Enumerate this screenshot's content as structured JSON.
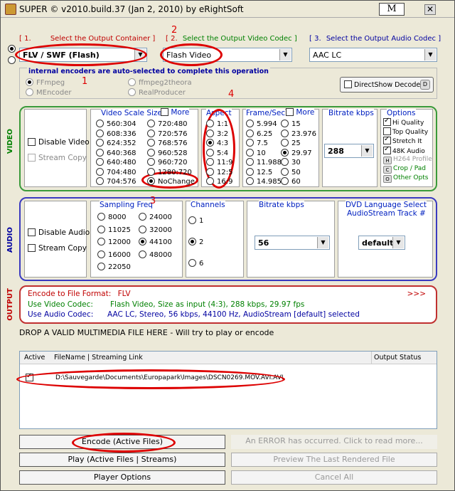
{
  "title": "SUPER © v2010.build.37 (Jan 2, 2010) by eRightSoft",
  "title_button": "M",
  "close_glyph": "✕",
  "step1": {
    "num": "[ 1.",
    "label": "Select the Output Container ]"
  },
  "step2": {
    "num": "[ 2.",
    "label": "Select the Output Video Codec ]"
  },
  "step3": {
    "num": "[ 3.",
    "label": "Select the Output Audio Codec ]"
  },
  "container_value": "FLV / SWF (Flash)",
  "video_codec_value": "Flash Video",
  "audio_codec_value": "AAC LC",
  "encoders": {
    "caption": "internal encoders are auto-selected to complete this operation",
    "items": [
      "FFmpeg",
      "ffmpeg2theora",
      "MEncoder",
      "RealProducer"
    ],
    "directshow": "DirectShow Decode",
    "directshow_badge": "D"
  },
  "video": {
    "section_label": "VIDEO",
    "disable": "Disable Video",
    "stream_copy": "Stream Copy",
    "scale_title": "Video Scale Size",
    "scale_more": "More",
    "scale_col1": [
      "560:304",
      "608:336",
      "624:352",
      "640:368",
      "640:480",
      "704:480",
      "704:576"
    ],
    "scale_col2": [
      "720:480",
      "720:576",
      "768:576",
      "960:528",
      "960:720",
      "1280:720",
      "NoChange"
    ],
    "aspect_title": "Aspect",
    "aspect": [
      "1:1",
      "3:2",
      "4:3",
      "5:4",
      "11:9",
      "12:5",
      "16:9"
    ],
    "fps_title": "Frame/Sec",
    "fps_more": "More",
    "fps_col1": [
      "5.994",
      "6.25",
      "7.5",
      "10",
      "11.988",
      "12.5",
      "14.985"
    ],
    "fps_col2": [
      "15",
      "23.976",
      "25",
      "29.97",
      "30",
      "50",
      "60"
    ],
    "bitrate_title": "Bitrate  kbps",
    "bitrate_value": "288",
    "options_title": "Options",
    "options": [
      "Hi Quality",
      "Top Quality",
      "Stretch It",
      "48K Audio",
      "H264 Profile",
      "Crop / Pad",
      "Other Opts"
    ],
    "options_badges": [
      "",
      "",
      "",
      "",
      "H",
      "C",
      "O"
    ]
  },
  "audio": {
    "section_label": "AUDIO",
    "disable": "Disable Audio",
    "stream_copy": "Stream Copy",
    "freq_title": "Sampling Freq",
    "freq_col1": [
      "8000",
      "11025",
      "12000",
      "16000",
      "22050"
    ],
    "freq_col2": [
      "24000",
      "32000",
      "44100",
      "48000"
    ],
    "channels_title": "Channels",
    "channels": [
      "1",
      "2",
      "6"
    ],
    "bitrate_title": "Bitrate  kbps",
    "bitrate_value": "56",
    "dvd_title": "DVD Language Select",
    "dvd_sub": "AudioStream  Track #",
    "dvd_value": "default"
  },
  "output": {
    "section_label": "OUTPUT",
    "format_label": "Encode to File Format:",
    "format_value": "FLV",
    "more": ">>>",
    "video_label": "Use Video Codec:",
    "video_value": "Flash Video,   Size as input (4:3),   288 kbps,   29.97 fps",
    "audio_label": "Use Audio Codec:",
    "audio_value": "AAC LC,   Stereo,   56 kbps,   44100 Hz,   AudioStream [default] selected"
  },
  "drop_text": "DROP A VALID MULTIMEDIA FILE HERE - Will try to play or encode",
  "filelist": {
    "columns": [
      "Active",
      "FileName  |  Streaming Link",
      "Output Status"
    ],
    "rows": [
      {
        "file": "D:\\Sauvegarde\\Documents\\Europapark\\Images\\DSCN0269.MOV.AVI.AVI"
      }
    ]
  },
  "buttons": {
    "encode": "Encode (Active Files)",
    "error": "An ERROR has occurred. Click to read more...",
    "play": "Play (Active Files | Streams)",
    "preview": "Preview The Last Rendered File",
    "player_options": "Player Options",
    "cancel_all": "Cancel All"
  },
  "annotations": [
    "1",
    "2",
    "3",
    "4"
  ]
}
